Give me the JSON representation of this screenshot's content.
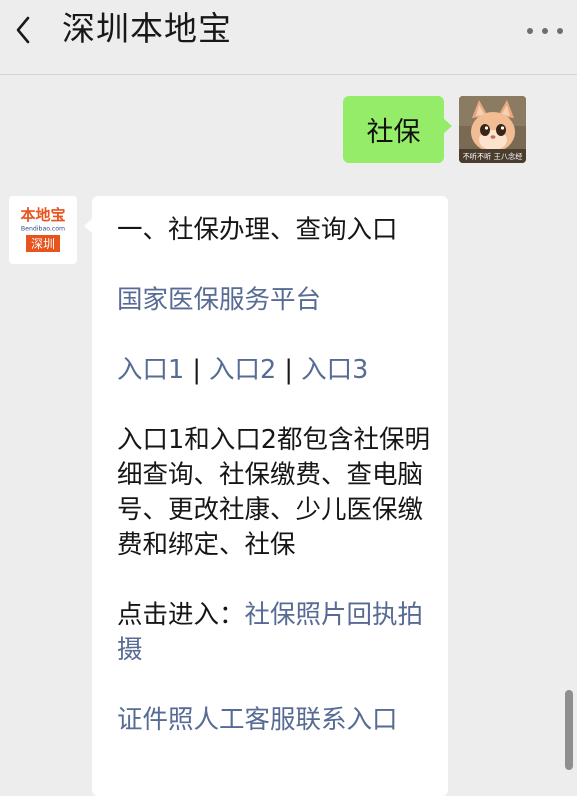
{
  "header": {
    "title": "深圳本地宝",
    "back_icon": "chevron-left-icon",
    "more_icon": "more-dots-icon"
  },
  "outgoing_message": {
    "text": "社保",
    "bubble_color": "#95ec69",
    "avatar_caption": "不听不听 王八念经"
  },
  "incoming_message": {
    "avatar": {
      "brand_text": "本地宝",
      "domain_text": "Bendibao.com",
      "city_text": "深圳",
      "accent_color": "#e8541e"
    },
    "heading": "一、社保办理、查询入口",
    "platform_link": "国家医保服务平台",
    "entry_1": "入口1",
    "entry_sep_1": " | ",
    "entry_2": "入口2",
    "entry_sep_2": " | ",
    "entry_3": "入口3",
    "description": "入口1和入口2都包含社保明细查询、社保缴费、查电脑号、更改社康、少儿医保缴费和绑定、社保",
    "click_prefix": "点击进入：",
    "photo_link": "社保照片回执拍摄",
    "service_link": "证件照人工客服联系入口",
    "link_color": "#576b95"
  }
}
